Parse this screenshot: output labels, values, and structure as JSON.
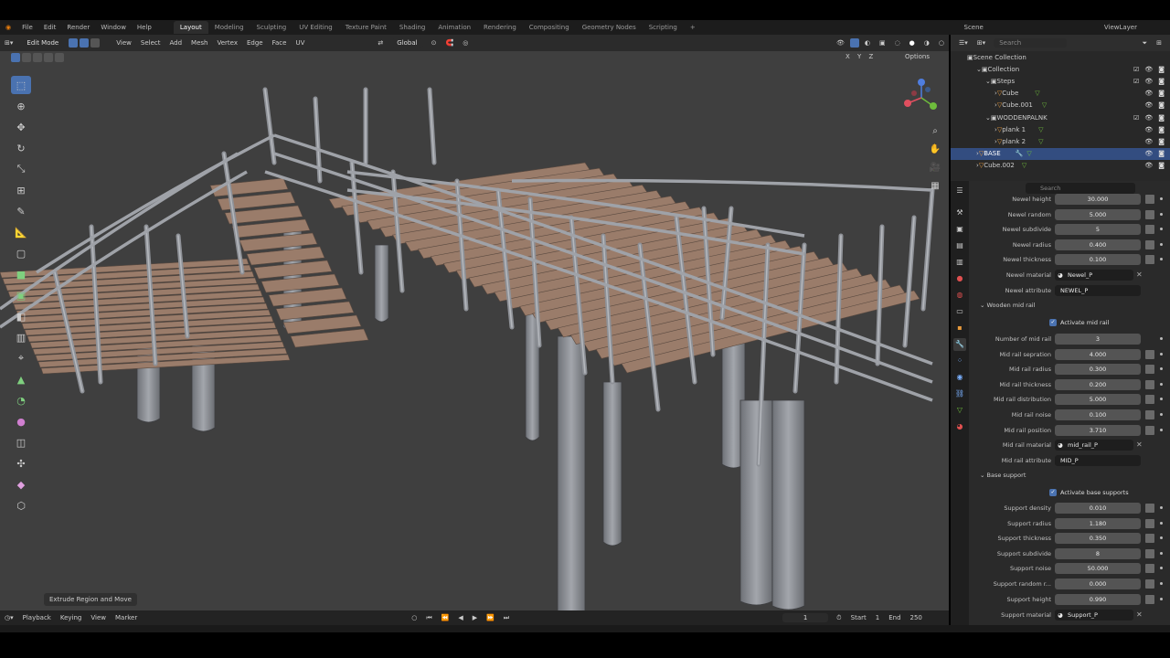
{
  "menus": [
    "File",
    "Edit",
    "Render",
    "Window",
    "Help"
  ],
  "workspaces": [
    "Layout",
    "Modeling",
    "Sculpting",
    "UV Editing",
    "Texture Paint",
    "Shading",
    "Animation",
    "Rendering",
    "Compositing",
    "Geometry Nodes",
    "Scripting"
  ],
  "active_workspace": "Layout",
  "scene_label": "Scene",
  "view_layer_label": "ViewLayer",
  "viewport": {
    "mode": "Edit Mode",
    "menu": [
      "View",
      "Select",
      "Add",
      "Mesh",
      "Vertex",
      "Edge",
      "Face",
      "UV"
    ],
    "transform_orientation": "Global",
    "axes": "X Y Z",
    "options_label": "Options",
    "last_operator": "Extrude Region and Move",
    "colors": {
      "background": "#3f3f3f",
      "plank": "#9a7c6a",
      "post": "#8d9096"
    }
  },
  "outliner": {
    "search_placeholder": "Search",
    "items": [
      {
        "label": "Scene Collection"
      },
      {
        "label": "Collection"
      },
      {
        "label": "Steps"
      },
      {
        "label": "Cube"
      },
      {
        "label": "Cube.001"
      },
      {
        "label": "WODDENPALNK"
      },
      {
        "label": "plank 1"
      },
      {
        "label": "plank 2"
      },
      {
        "label": "BASE"
      },
      {
        "label": "Cube.002"
      }
    ]
  },
  "properties": {
    "search_placeholder": "Search",
    "newel": [
      {
        "label": "Newel height",
        "value": "30.000"
      },
      {
        "label": "Newel random",
        "value": "5.000"
      },
      {
        "label": "Newel subdivide",
        "value": "5"
      },
      {
        "label": "Newel radius",
        "value": "0.400"
      },
      {
        "label": "Newel thickness",
        "value": "0.100"
      }
    ],
    "newel_material": {
      "label": "Newel material",
      "value": "Newel_P"
    },
    "newel_attribute": {
      "label": "Newel attribute",
      "value": "NEWEL_P"
    },
    "wooden_mid_rail_section": "Wooden mid rail",
    "activate_mid_rail": "Activate mid rail",
    "mid_rail": [
      {
        "label": "Number of mid rail",
        "value": "3"
      },
      {
        "label": "Mid rail sepration",
        "value": "4.000"
      },
      {
        "label": "Mid rail radius",
        "value": "0.300"
      },
      {
        "label": "Mid rail thickness",
        "value": "0.200"
      },
      {
        "label": "Mid rail distribution",
        "value": "5.000"
      },
      {
        "label": "Mid rail noise",
        "value": "0.100"
      },
      {
        "label": "Mid rail position",
        "value": "3.710"
      }
    ],
    "mid_rail_material": {
      "label": "Mid rail material",
      "value": "mid_rail_P"
    },
    "mid_rail_attribute": {
      "label": "Mid rail attribute",
      "value": "MID_P"
    },
    "base_support_section": "Base support",
    "activate_base_supports": "Activate base supports",
    "support": [
      {
        "label": "Support density",
        "value": "0.010"
      },
      {
        "label": "Support radius",
        "value": "1.180"
      },
      {
        "label": "Support thickness",
        "value": "0.350"
      },
      {
        "label": "Support subdivide",
        "value": "8"
      },
      {
        "label": "Support noise",
        "value": "50.000"
      },
      {
        "label": "Support  random r...",
        "value": "0.000"
      },
      {
        "label": "Support height",
        "value": "0.990"
      }
    ],
    "support_material": {
      "label": "Support material",
      "value": "Support_P"
    }
  },
  "timeline": {
    "menu": [
      "Playback",
      "Keying",
      "View",
      "Marker"
    ],
    "current_frame": "1",
    "start_label": "Start",
    "start": "1",
    "end_label": "End",
    "end": "250"
  }
}
